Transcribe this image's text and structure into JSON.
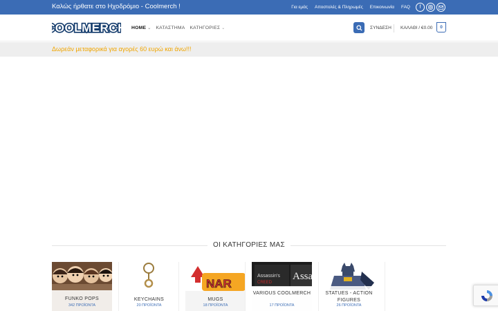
{
  "topbar": {
    "welcome": "Καλώς ήρθατε στο Ηχοδρόμιο - Coolmerch !",
    "links": [
      "Για εμάς",
      "Αποστολές & Πληρωμές",
      "Επικοινωνία",
      "FAQ"
    ],
    "social_icons": [
      "facebook-icon",
      "instagram-icon",
      "email-icon"
    ]
  },
  "header": {
    "logo_text": "COOLMERCH",
    "nav": [
      {
        "label": "HOME",
        "active": true,
        "dropdown": true
      },
      {
        "label": "ΚΑΤΑΣΤΗΜΑ",
        "active": false,
        "dropdown": false
      },
      {
        "label": "ΚΑΤΗΓΟΡΙΕΣ",
        "active": false,
        "dropdown": true
      }
    ],
    "login": "ΣΥΝΔΕΣΗ",
    "cart": "ΚΑΛΑΘΙ / €0.00",
    "cart_count": "0"
  },
  "notice": "Δωρεάν μεταφορικά για αγορές 60 ευρώ και άνω!!!",
  "categories_section": {
    "title": "ΟΙ ΚΑΤΗΓΟΡΙΕΣ ΜΑΣ",
    "items": [
      {
        "name": "FUNKO POPS",
        "count": "342 ΠΡΟΪΟΝΤΑ"
      },
      {
        "name": "KEYCHAINS",
        "count": "20 ΠΡΟΪΟΝΤΑ"
      },
      {
        "name": "MUGS",
        "count": "18 ΠΡΟΪΟΝΤΑ"
      },
      {
        "name": "VARIOUS COOLMERCH",
        "count": "17 ΠΡΟΪΟΝΤΑ"
      },
      {
        "name": "STATUES - ACTION FIGURES",
        "count": "26 ΠΡΟΪΟΝΤΑ"
      }
    ]
  },
  "colors": {
    "brand": "#3b6cb5",
    "notice": "#f0a500"
  }
}
